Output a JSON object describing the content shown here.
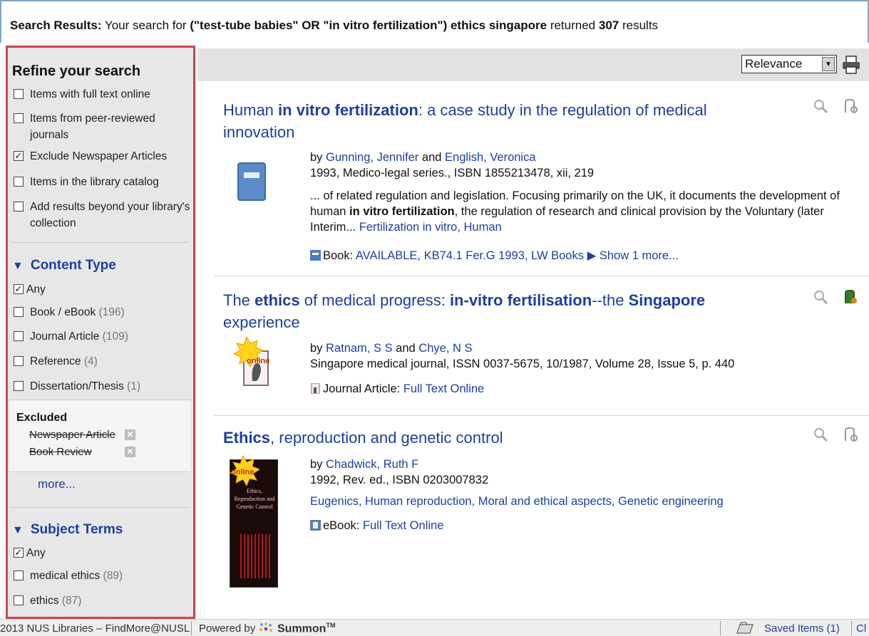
{
  "header": {
    "prefix": "Search Results:",
    "your_search_for": "Your search for",
    "query": "(\"test-tube babies\" OR \"in vitro fertilization\") ethics singapore",
    "returned": "returned",
    "count": "307",
    "results_word": "results"
  },
  "sidebar": {
    "refine_title": "Refine your search",
    "refine_options": [
      {
        "label": "Items with full text online",
        "checked": false
      },
      {
        "label": "Items from peer-reviewed journals",
        "checked": false
      },
      {
        "label": "Exclude Newspaper Articles",
        "checked": true
      },
      {
        "label": "Items in the library catalog",
        "checked": false
      },
      {
        "label": "Add results beyond your library's collection",
        "checked": false
      }
    ],
    "content_type": {
      "title": "Content Type",
      "options": [
        {
          "label": "Any",
          "count": "",
          "checked": true
        },
        {
          "label": "Book / eBook",
          "count": "(196)",
          "checked": false
        },
        {
          "label": "Journal Article",
          "count": "(109)",
          "checked": false
        },
        {
          "label": "Reference",
          "count": "(4)",
          "checked": false
        },
        {
          "label": "Dissertation/Thesis",
          "count": "(1)",
          "checked": false
        }
      ]
    },
    "excluded": {
      "title": "Excluded",
      "items": [
        "Newspaper Article",
        "Book Review"
      ]
    },
    "more_label": "more...",
    "subject_terms": {
      "title": "Subject Terms",
      "options": [
        {
          "label": "Any",
          "count": "",
          "checked": true
        },
        {
          "label": "medical ethics",
          "count": "(89)",
          "checked": false
        },
        {
          "label": "ethics",
          "count": "(87)",
          "checked": false
        }
      ]
    }
  },
  "toolbar": {
    "sort_value": "Relevance",
    "print_icon": "print-icon"
  },
  "results": [
    {
      "title_parts": [
        {
          "t": "Human ",
          "b": false
        },
        {
          "t": "in vitro fertilization",
          "b": true
        },
        {
          "t": ": a case study in the regulation of medical innovation",
          "b": false
        }
      ],
      "by": "by",
      "author1": "Gunning, Jennifer",
      "and": "and",
      "author2": "English, Veronica",
      "pub": "1993, Medico-legal series., ISBN 1855213478, xii, 219",
      "snippet_parts": [
        {
          "t": "... of related regulation and legislation. Focusing primarily on the UK, it documents the development of human ",
          "b": false
        },
        {
          "t": "in vitro fertilization",
          "b": true
        },
        {
          "t": ", the regulation of research and clinical provision by the Voluntary (later Interim... ",
          "b": false
        }
      ],
      "subject_link": "Fertilization in vitro, Human",
      "format_label": "Book:",
      "availability": "AVAILABLE, KB74.1 Fer.G 1993, LW Books",
      "show_more": "▶ Show 1 more..."
    },
    {
      "title_parts": [
        {
          "t": "The ",
          "b": false
        },
        {
          "t": "ethics",
          "b": true
        },
        {
          "t": " of medical progress: ",
          "b": false
        },
        {
          "t": "in-vitro fertilisation",
          "b": true
        },
        {
          "t": "--the ",
          "b": false
        },
        {
          "t": "Singapore",
          "b": true
        },
        {
          "t": " experience",
          "b": false
        }
      ],
      "by": "by",
      "author1": "Ratnam, S S",
      "and": "and",
      "author2": "Chye, N S",
      "pub": "Singapore medical journal, ISSN 0037-5675, 10/1987, Volume 28, Issue 5, p. 440",
      "badge": "online",
      "format_label": "Journal Article:",
      "availability": "Full Text Online"
    },
    {
      "title_parts": [
        {
          "t": "Ethics",
          "b": true
        },
        {
          "t": ", reproduction and genetic control",
          "b": false
        }
      ],
      "by": "by",
      "author1": "Chadwick, Ruth F",
      "pub": "1992, Rev. ed., ISBN 0203007832",
      "subjects": "Eugenics, Human reproduction, Moral and ethical aspects, Genetic engineering",
      "badge": "online",
      "cover_title": "Ethics, Reproduction and Genetic Control",
      "format_label": "eBook:",
      "availability": "Full Text Online"
    }
  ],
  "footer": {
    "copyright": "2013 NUS Libraries – FindMore@NUSL",
    "powered_by": "Powered by",
    "brand": "Summon",
    "tm": "TM",
    "saved_items": "Saved Items (1)",
    "cut_off": "Cl"
  }
}
